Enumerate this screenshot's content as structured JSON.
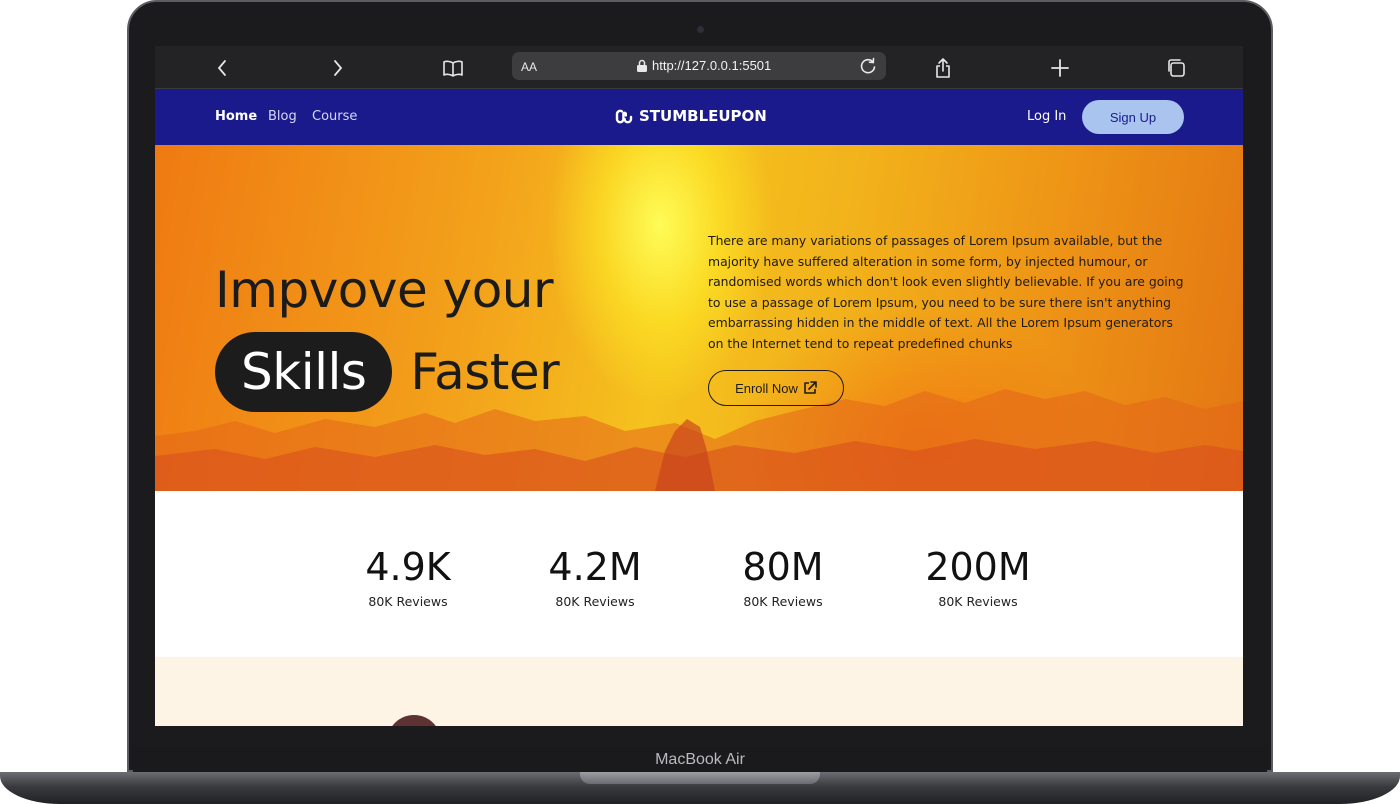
{
  "device": {
    "label": "MacBook Air"
  },
  "browser": {
    "reader_label": "AA",
    "url": "http://127.0.0.1:5501"
  },
  "nav": {
    "links": [
      "Home",
      "Blog",
      "Course"
    ],
    "logo_text": "STUMBLEUPON",
    "login": "Log In",
    "signup": "Sign Up"
  },
  "hero": {
    "headline_line1": "Impvove your",
    "headline_highlight": "Skills",
    "headline_line2_rest": "Faster",
    "description": "There are many variations of passages of Lorem Ipsum available, but the majority have suffered alteration in some form, by injected humour, or randomised words which don't look even slightly believable. If you are going to use a passage of Lorem Ipsum, you need to be sure there isn't anything embarrassing hidden in the middle of text. All the Lorem Ipsum generators on the Internet tend to repeat predefined chunks",
    "cta": "Enroll Now"
  },
  "stats": [
    {
      "value": "4.9K",
      "label": "80K Reviews"
    },
    {
      "value": "4.2M",
      "label": "80K Reviews"
    },
    {
      "value": "80M",
      "label": "80K Reviews"
    },
    {
      "value": "200M",
      "label": "80K Reviews"
    }
  ],
  "next_section": {
    "heading_peek": ""
  },
  "colors": {
    "nav_bg": "#1a1a8c",
    "signup_bg": "#a9c4ee",
    "hero_orange": "#f3a21b",
    "cream": "#fdf4e6"
  }
}
